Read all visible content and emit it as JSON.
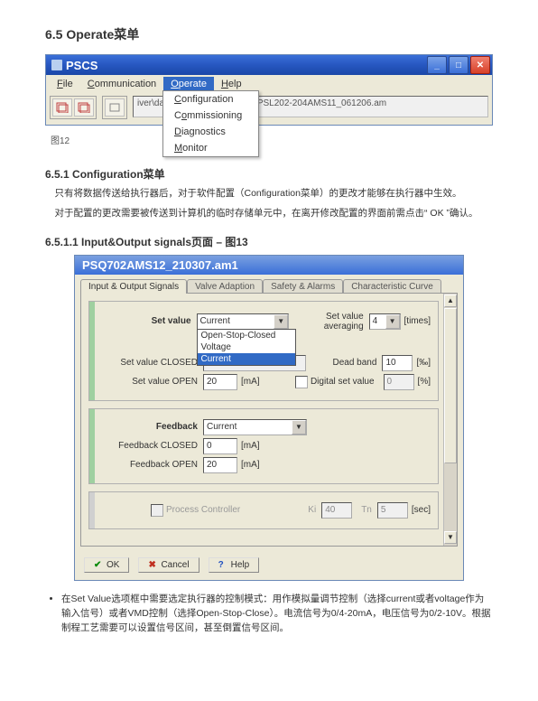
{
  "headings": {
    "h65": "6.5 Operate菜单",
    "fig12": "图12",
    "h651": "6.5.1 Configuration菜单",
    "h6511": "6.5.1.1 Input&Output signals页面 – 图13"
  },
  "para651a": "只有将数据传送给执行器后，对于软件配置（Configuration菜单）的更改才能够在执行器中生效。",
  "para651b": "对于配置的更改需要被传送到计算机的临时存储单元中，在离开修改配置的界面前需点击“ OK ”确认。",
  "bullet1": "在Set Value选项框中需要选定执行器的控制模式：用作模拟量调节控制（选择current或者voltage作为输入信号）或者VMD控制（选择Open-Stop-Close）。电流信号为0/4-20mA，电压信号为0/2-10V。根据制程工艺需要可以设置信号区间，甚至倒置信号区间。",
  "win1": {
    "title": "PSCS",
    "menu": {
      "file": "File",
      "file_u": "F",
      "comm": "Communication",
      "comm_u": "C",
      "operate": "Operate",
      "operate_u": "O",
      "help": "Help",
      "help_u": "H"
    },
    "dropdown": {
      "config": "Configuration",
      "config_u": "C",
      "commis": "Commissioning",
      "commis_u": "o",
      "diag": "Diagnostics",
      "diag_u": "D",
      "monitor": "Monitor",
      "monitor_u": "M"
    },
    "path": "iver\\datensatz\\AMS\\Standard\\PSL202-204AMS11_061206.am"
  },
  "dialog": {
    "title": "PSQ702AMS12_210307.am1",
    "tabs": {
      "t1": "Input & Output Signals",
      "t2": "Valve Adaption",
      "t3": "Safety & Alarms",
      "t4": "Characteristic Curve"
    },
    "setvalue": {
      "label": "Set value",
      "selected": "Current",
      "opts": {
        "o1": "Open-Stop-Closed",
        "o2": "Voltage",
        "o3": "Current"
      },
      "closed_label": "Set value CLOSED",
      "closed_val": "",
      "open_label": "Set value OPEN",
      "open_val": "20",
      "open_unit": "[mA]",
      "avg_label": "Set value averaging",
      "avg_val": "4",
      "avg_unit": "[times]",
      "dead_label": "Dead band",
      "dead_val": "10",
      "dead_unit": "[‰]",
      "dig_label": "Digital set value",
      "dig_val": "0",
      "dig_unit": "[%]"
    },
    "feedback": {
      "label": "Feedback",
      "selected": "Current",
      "closed_label": "Feedback CLOSED",
      "closed_val": "0",
      "closed_unit": "[mA]",
      "open_label": "Feedback OPEN",
      "open_val": "20",
      "open_unit": "[mA]"
    },
    "pc": {
      "label": "Process Controller",
      "ki_label": "Ki",
      "ki_val": "40",
      "tn_label": "Tn",
      "tn_val": "5",
      "tn_unit": "[sec]"
    },
    "buttons": {
      "ok": "OK",
      "cancel": "Cancel",
      "help": "Help"
    }
  }
}
